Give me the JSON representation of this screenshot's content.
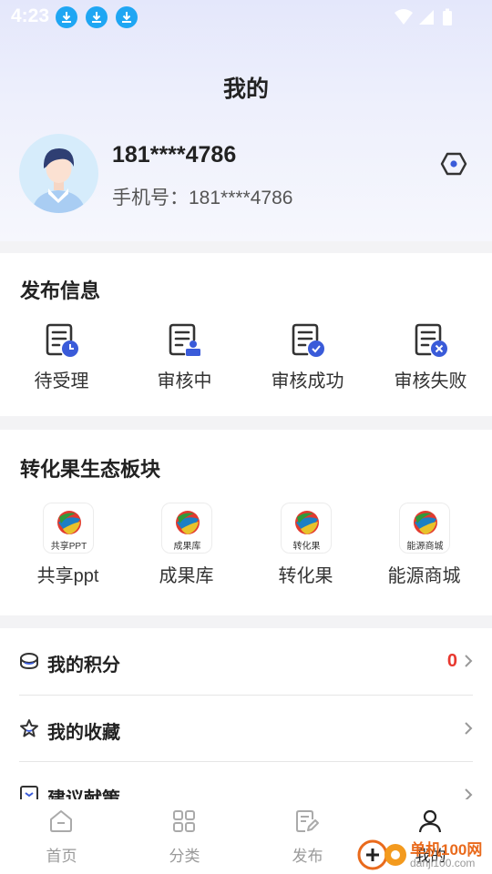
{
  "status_bar": {
    "time": "4:23"
  },
  "page": {
    "title": "我的"
  },
  "user": {
    "name": "181****4786",
    "phone": "手机号：181****4786"
  },
  "publish_section": {
    "title": "发布信息",
    "items": [
      {
        "label": "待受理",
        "icon": "pending-doc-icon"
      },
      {
        "label": "审核中",
        "icon": "reviewing-doc-icon"
      },
      {
        "label": "审核成功",
        "icon": "approved-doc-icon"
      },
      {
        "label": "审核失败",
        "icon": "rejected-doc-icon"
      }
    ]
  },
  "ecosystem_section": {
    "title": "转化果生态板块",
    "items": [
      {
        "label": "共享ppt",
        "tile_text": "共享PPT"
      },
      {
        "label": "成果库",
        "tile_text": "成果库"
      },
      {
        "label": "转化果",
        "tile_text": "转化果"
      },
      {
        "label": "能源商城",
        "tile_text": "能源商城"
      }
    ]
  },
  "menu": [
    {
      "label": "我的积分",
      "value": "0",
      "icon": "points-icon"
    },
    {
      "label": "我的收藏",
      "value": "",
      "icon": "star-icon"
    },
    {
      "label": "建议献策",
      "value": "",
      "icon": "suggestion-icon"
    }
  ],
  "tabbar": [
    {
      "label": "首页",
      "icon": "home-icon",
      "active": false
    },
    {
      "label": "分类",
      "icon": "grid-icon",
      "active": false
    },
    {
      "label": "发布",
      "icon": "publish-icon",
      "active": false
    },
    {
      "label": "我的",
      "icon": "user-icon",
      "active": true
    }
  ],
  "watermark": {
    "line1": "单机100网",
    "line2": "danji100.com"
  },
  "colors": {
    "accent": "#3a5bd9",
    "status_blue": "#1fa6f3",
    "points_red": "#e8382f",
    "gradient_top": "#e4e7fb"
  }
}
